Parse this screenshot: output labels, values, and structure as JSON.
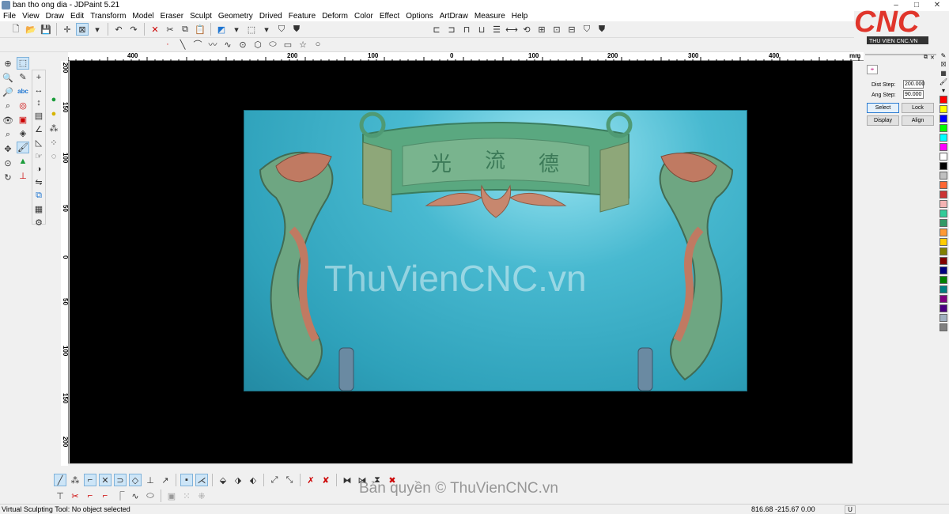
{
  "window": {
    "title": "ban tho ong dia - JDPaint 5.21",
    "controls": [
      "–",
      "□",
      "✕"
    ]
  },
  "menu": [
    "File",
    "View",
    "Draw",
    "Edit",
    "Transform",
    "Model",
    "Eraser",
    "Sculpt",
    "Geometry",
    "Drived",
    "Feature",
    "Deform",
    "Color",
    "Effect",
    "Options",
    "ArtDraw",
    "Measure",
    "Help"
  ],
  "logo": {
    "text": "CNC",
    "subtitle": "THU VIEN CNC.VN",
    "color": "#e0352b"
  },
  "ruler": {
    "top_labels": [
      "400",
      "200",
      "100",
      "0",
      "100",
      "200",
      "300",
      "400"
    ],
    "unit": "mm",
    "left_labels": [
      "200",
      "150",
      "100",
      "50",
      "0",
      "50",
      "100",
      "150",
      "200"
    ]
  },
  "canvas": {
    "watermark": "ThuVienCNC.vn",
    "calligraphy": [
      "光",
      "流",
      "德"
    ]
  },
  "panel": {
    "dist_step_label": "Dist Step:",
    "dist_step_value": "200.000",
    "ang_step_label": "Ang Step:",
    "ang_step_value": "90.000",
    "buttons": [
      "Select",
      "Lock",
      "Display",
      "Align"
    ]
  },
  "palette": [
    "#ff0000",
    "#ffff00",
    "#0000ff",
    "#00ff00",
    "#00ffff",
    "#ff00ff",
    "#ffffff",
    "#000000",
    "#c0c0c0",
    "#ff6633",
    "#cc3333",
    "#f4b3b3",
    "#33cc99",
    "#339966",
    "#ff9933",
    "#ffcc00",
    "#808000",
    "#800000",
    "#000080",
    "#008000",
    "#008080",
    "#800080",
    "#4b0082",
    "#a0b0c0",
    "#808080"
  ],
  "copyright": "Bản quyền © ThuVienCNC.vn",
  "status": {
    "message": "Virtual Sculpting Tool: No object selected",
    "coords": "816.68 -215.67 0.00",
    "unit": "U"
  }
}
